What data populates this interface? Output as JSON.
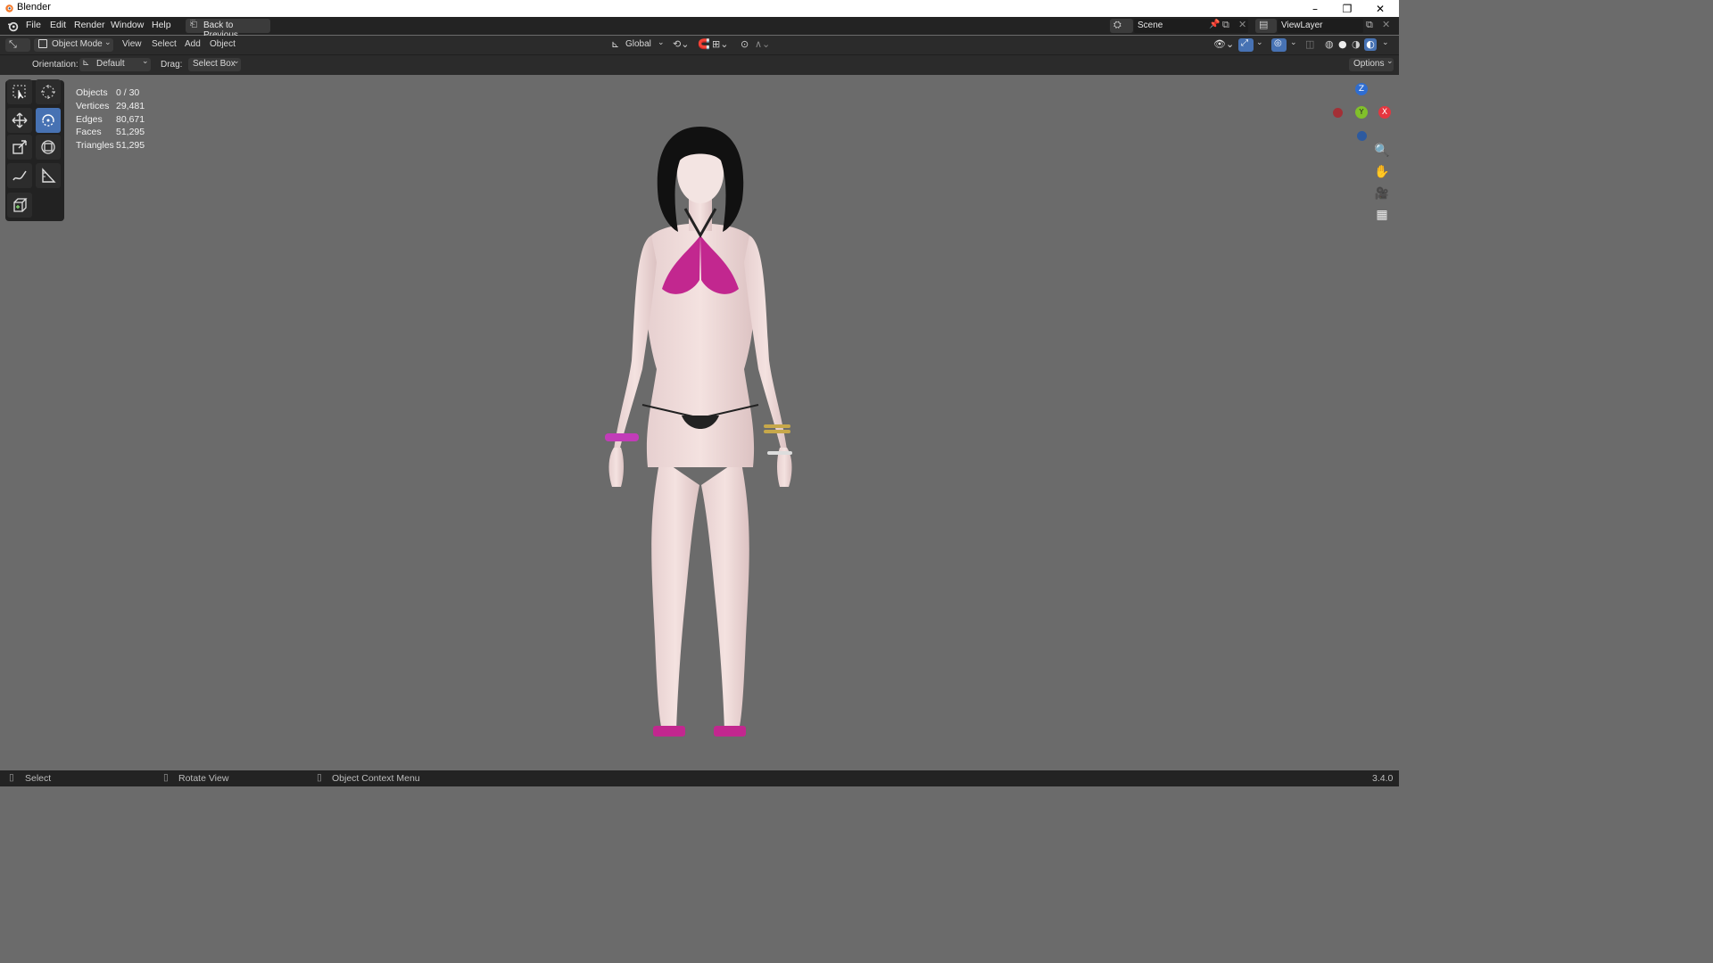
{
  "window": {
    "title": "Blender",
    "min": "–",
    "max": "❐",
    "close": "✕"
  },
  "topbar": {
    "menus": [
      "File",
      "Edit",
      "Render",
      "Window",
      "Help"
    ],
    "back_button": "Back to Previous",
    "scene": "Scene",
    "view_layer": "ViewLayer"
  },
  "header": {
    "mode": "Object Mode",
    "menus": [
      "View",
      "Select",
      "Add",
      "Object"
    ],
    "transform_orientation": "Global"
  },
  "tool_settings": {
    "orientation_label": "Orientation:",
    "orientation_value": "Default",
    "drag_label": "Drag:",
    "drag_value": "Select Box",
    "options": "Options"
  },
  "stats": [
    {
      "label": "Objects",
      "value": "0 / 30"
    },
    {
      "label": "Vertices",
      "value": "29,481"
    },
    {
      "label": "Edges",
      "value": "80,671"
    },
    {
      "label": "Faces",
      "value": "51,295"
    },
    {
      "label": "Triangles",
      "value": "51,295"
    }
  ],
  "gizmo": {
    "z": "Z",
    "y": "Y",
    "x": "X",
    "colors": {
      "x": "#e5363f",
      "y": "#81c02a",
      "z": "#2f6dd0"
    }
  },
  "statusbar": {
    "select": "Select",
    "rotate": "Rotate View",
    "context": "Object Context Menu",
    "version": "3.4.0"
  },
  "colors": {
    "viewport_bg": "#6b6b6b",
    "accent": "#4772b3",
    "bikini": "#c2278f"
  }
}
